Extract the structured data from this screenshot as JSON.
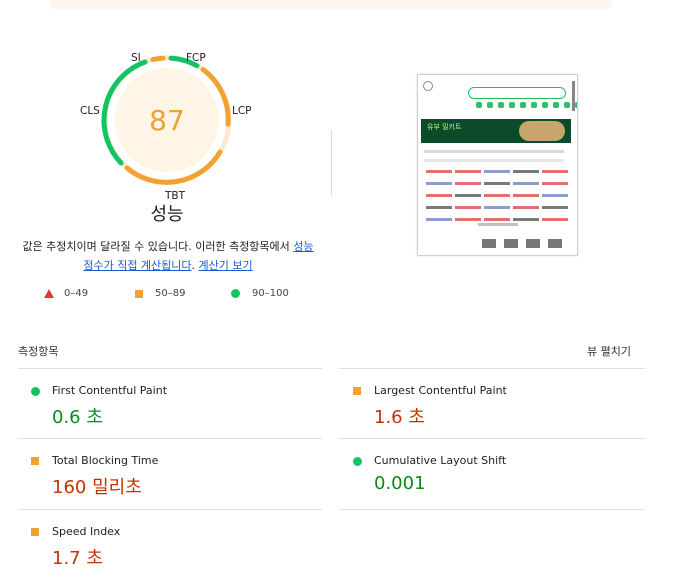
{
  "gauge": {
    "score": "87",
    "title": "성능",
    "labels": {
      "si": "SI",
      "fcp": "FCP",
      "lcp": "LCP",
      "tbt": "TBT",
      "cls": "CLS"
    }
  },
  "description": {
    "text": "값은 추정치이며 달라질 수 있습니다. 이러한 측정항목에서 ",
    "link1": "성능 점수가 직접 계산됩니다",
    "period": ". ",
    "link2": "계산기 보기"
  },
  "legend": {
    "fail": "0–49",
    "average": "50–89",
    "pass": "90–100"
  },
  "metrics_section": {
    "title": "측정항목",
    "expand_label": "뷰 펼치기"
  },
  "metrics": [
    {
      "name": "First Contentful Paint",
      "value": "0.6 초",
      "status": "pass"
    },
    {
      "name": "Largest Contentful Paint",
      "value": "1.6 초",
      "status": "average"
    },
    {
      "name": "Total Blocking Time",
      "value": "160 밀리초",
      "status": "average"
    },
    {
      "name": "Cumulative Layout Shift",
      "value": "0.001",
      "status": "pass"
    },
    {
      "name": "Speed Index",
      "value": "1.7 초",
      "status": "average"
    }
  ],
  "thumbnail": {
    "banner_text": "유부 밀키트"
  },
  "colors": {
    "pass": "#12c463",
    "average": "#f2a233",
    "fail": "#e53935"
  }
}
